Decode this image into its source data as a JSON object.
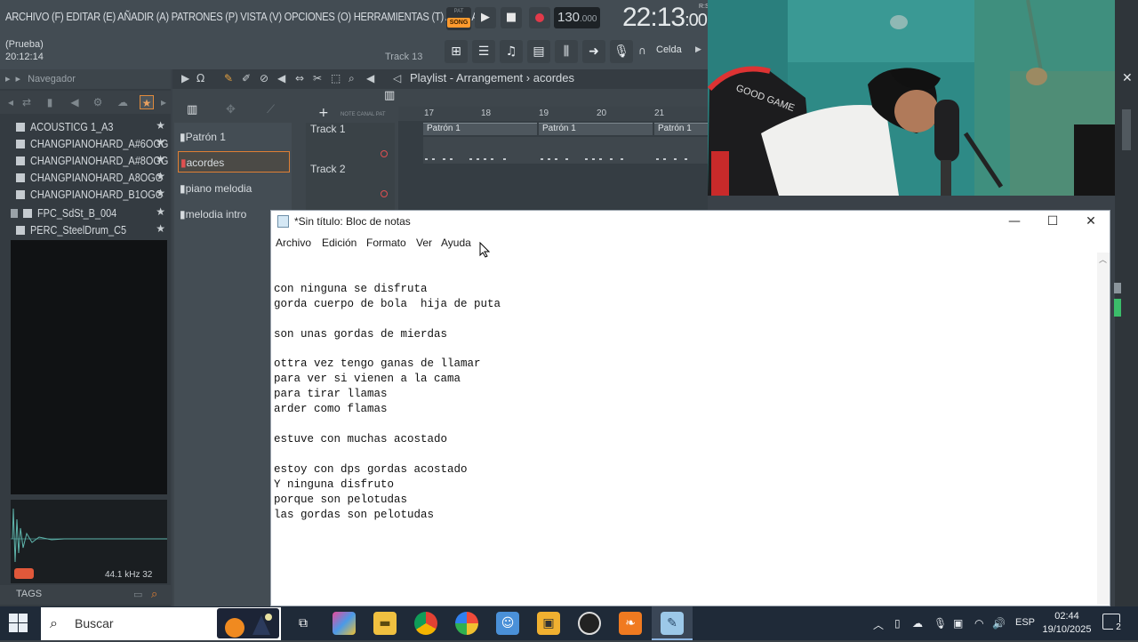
{
  "fl": {
    "menu": "ARCHIVO (F) EDITAR (E) AÑADIR (A) PATRONES (P) VISTA (V) OPCIONES (O) HERRAMIENTAS (T) AYUDA",
    "pat_label": "PAT",
    "song_label": "SONG",
    "tempo": "130",
    "tempo_dec": ".000",
    "clock_main": "22:13",
    "clock_sub": ":00",
    "clock_rs": "R:S",
    "project": "(Prueba)",
    "project_time": "20:12:14",
    "track_label": "Track 13",
    "snap": "Celda"
  },
  "browser": {
    "title": "Navegador",
    "items": [
      {
        "name": "ACOUSTICG 1_A3"
      },
      {
        "name": "CHANGPIANOHARD_A#6OGG"
      },
      {
        "name": "CHANGPIANOHARD_A#8OGG"
      },
      {
        "name": "CHANGPIANOHARD_A8OGG"
      },
      {
        "name": "CHANGPIANOHARD_B1OGG"
      },
      {
        "name": "FPC_SdSt_B_004"
      },
      {
        "name": "PERC_SteelDrum_C5"
      }
    ],
    "sample_info": "44.1 kHz 32",
    "tags": "TAGS"
  },
  "playlist": {
    "title": "Playlist - Arrangement",
    "pattern_name": "acordes",
    "patterns": [
      "Patrón 1",
      "acordes",
      "piano melodia",
      "melodia intro"
    ],
    "tracks": [
      "Track 1",
      "Track 2"
    ],
    "ruler": [
      "17",
      "18",
      "19",
      "20",
      "21"
    ],
    "clip_label": "Patrón 1",
    "ruler_small": "NOTE CANAL PAT"
  },
  "notepad": {
    "title": "*Sin título: Bloc de notas",
    "menu": [
      "Archivo",
      "Edición",
      "Formato",
      "Ver",
      "Ayuda"
    ],
    "lines": [
      "con ninguna se disfruta",
      "gorda cuerpo de bola  hija de puta",
      "",
      "son unas gordas de mierdas",
      "",
      "ottra vez tengo ganas de llamar",
      "para ver si vienen a la cama",
      "para tirar llamas",
      "arder como flamas",
      "",
      "estuve con muchas acostado",
      "",
      "estoy con dps gordas acostado",
      "Y ninguna disfruto",
      "porque son pelotudas",
      "las gordas son pelotudas"
    ]
  },
  "taskbar": {
    "search": "Buscar",
    "lang": "ESP",
    "time": "02:44",
    "date": "19/10/2025",
    "notifications": "2"
  },
  "webcam": {
    "chair_text": "GOOD GAME"
  }
}
